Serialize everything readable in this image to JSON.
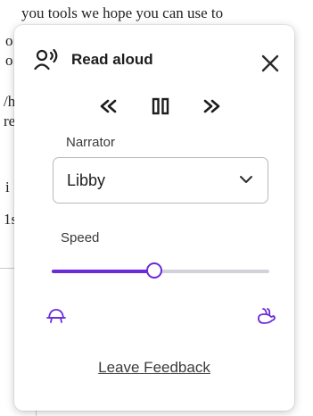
{
  "background": {
    "lines": [
      "you tools we hope you can use to",
      "o",
      "o",
      "/h",
      "re",
      "i",
      "1s"
    ]
  },
  "panel": {
    "title": "Read aloud",
    "header_icon": "speaking-person-icon",
    "close_icon": "close-icon",
    "controls": {
      "rewind_icon": "rewind-icon",
      "pause_icon": "pause-icon",
      "forward_icon": "fast-forward-icon"
    },
    "narrator": {
      "label": "Narrator",
      "value": "Libby"
    },
    "speed": {
      "label": "Speed",
      "value_fraction": 0.47,
      "slow_icon": "turtle-icon",
      "fast_icon": "rabbit-icon"
    },
    "feedback_link": "Leave Feedback"
  },
  "colors": {
    "accent": "#6a2bd8",
    "track": "#d4d1db",
    "text": "#1d1d1d"
  }
}
